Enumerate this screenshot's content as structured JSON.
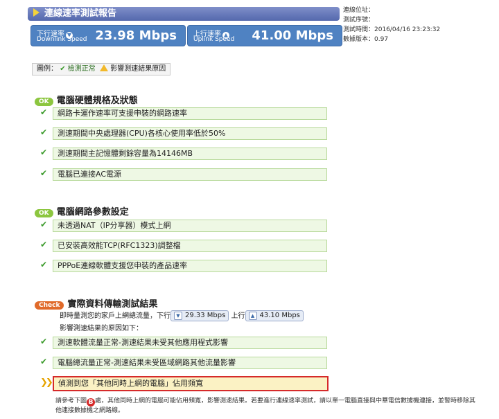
{
  "header": {
    "title": "連線速率測試報告"
  },
  "info": {
    "location_label": "連線位址：",
    "serial_label": "測試序號：",
    "time_line": "測試時間：2016/04/16 23:23:32",
    "version_line": "數據版本：0.97"
  },
  "downlink": {
    "label": "下行速率",
    "label_en": "Downlink Speed",
    "value": "23.98 Mbps",
    "icon": "chevron-down-icon"
  },
  "uplink": {
    "label": "上行速率",
    "label_en": "Uplink Speed",
    "value": "41.00 Mbps",
    "icon": "chevron-up-icon"
  },
  "legend": {
    "prefix": "圖例：",
    "ok": "檢測正常",
    "warn": "影響測速結果原因"
  },
  "sections": [
    {
      "badge": "OK",
      "title": "電腦硬體規格及狀態",
      "items": [
        "網路卡運作速率可支援申裝的網路速率",
        "測速期間中央處理器(CPU)各核心使用率低於50%",
        "測速期間主記憶體剩餘容量為14146MB",
        "電腦已連接AC電源"
      ]
    },
    {
      "badge": "OK",
      "title": "電腦網路參數設定",
      "items": [
        "未透過NAT（IP分享器）模式上網",
        "已安裝高效能TCP(RFC1323)調整檔",
        "PPPoE連線軟體支援您申裝的產品速率"
      ]
    },
    {
      "badge": "Check",
      "title": "實際資料傳輸測試結果",
      "measure_prefix": "即時量測您的家戶上網總流量，下行",
      "measure_down": "29.33 Mbps",
      "measure_mid": "上行",
      "measure_up": "43.10 Mbps",
      "reason_line": "影響測速結果的原因如下：",
      "items": [
        "測速軟體流量正常-測速結果未受其他應用程式影響",
        "電腦總流量正常-測速結果未受區域網路其他流量影響"
      ],
      "alert": "偵測到您「其他同時上網的電腦」佔用頻寬"
    }
  ],
  "note": {
    "part1": "請參考下圖",
    "marker": "B",
    "part2": "處，其他同時上網的電腦可能佔用頻寬，影響測速結果。若要進行連線速率測試，請以單一電腦直接與中華電信數據機連接，並暫時移除其他連接數據機之網路線。"
  },
  "colors": {
    "title_bar": "#5468ad",
    "speed_card": "#4f82c2",
    "ok_badge": "#8cc63f",
    "check_badge": "#e06a2a",
    "alert_border": "#d62a2a",
    "alert_bg": "#fbf2c4"
  }
}
